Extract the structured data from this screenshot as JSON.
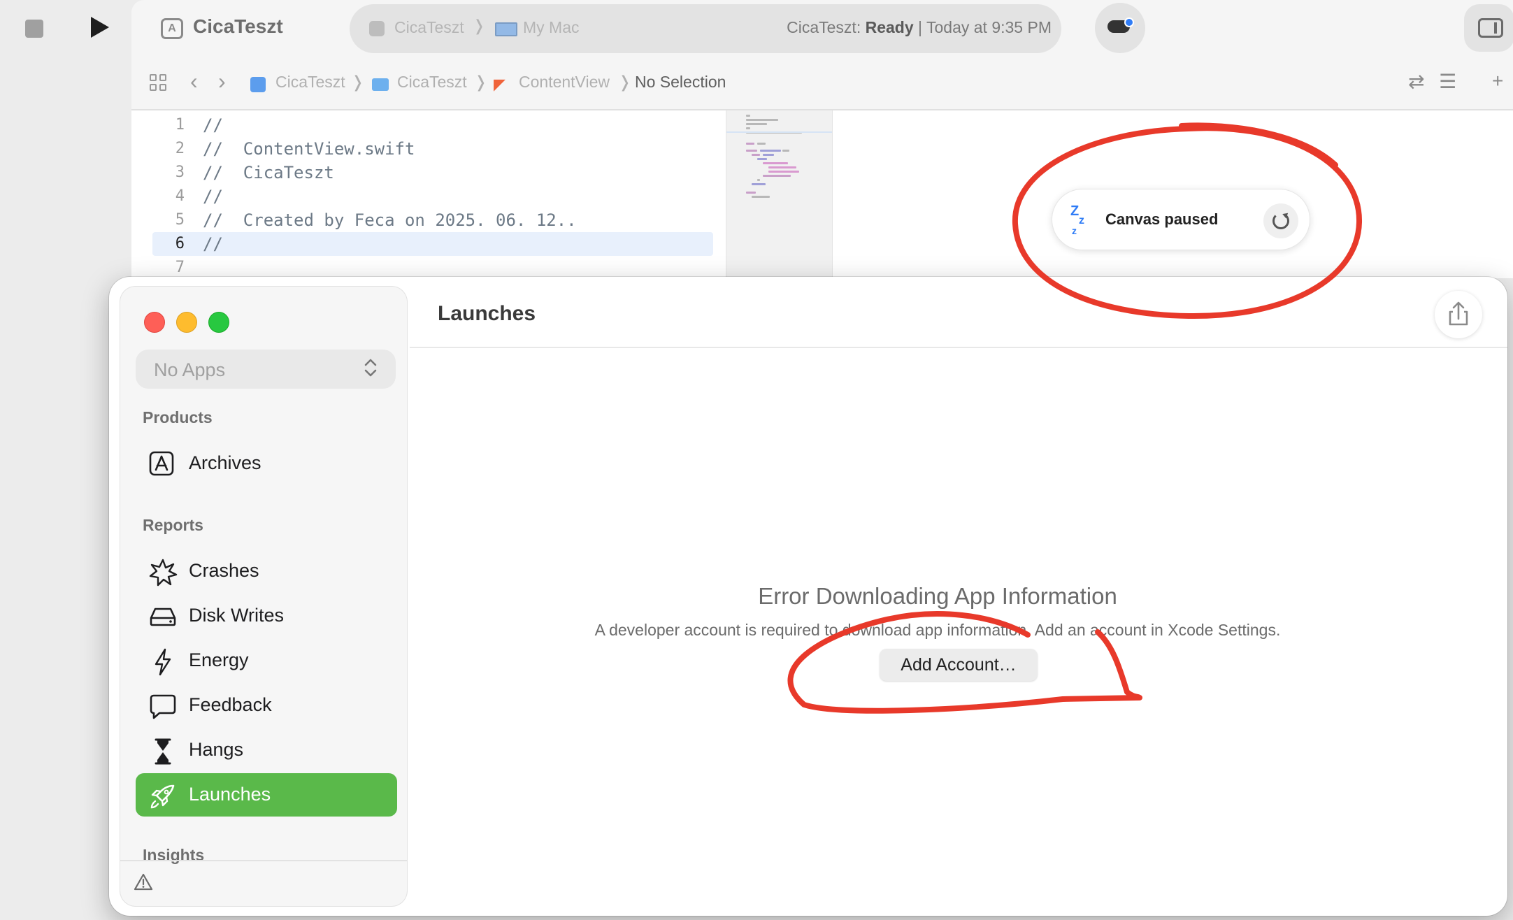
{
  "xcode": {
    "project_title": "CicaTeszt",
    "scheme": {
      "app": "CicaTeszt",
      "destination": "My Mac",
      "status_prefix": "CicaTeszt:",
      "status_state": "Ready",
      "status_time": "| Today at 9:35 PM"
    },
    "jump_bar": {
      "project": "CicaTeszt",
      "folder": "CicaTeszt",
      "file": "ContentView",
      "selection": "No Selection"
    },
    "code_lines": [
      {
        "n": "1",
        "text": "//"
      },
      {
        "n": "2",
        "text": "//  ContentView.swift"
      },
      {
        "n": "3",
        "text": "//  CicaTeszt"
      },
      {
        "n": "4",
        "text": "//"
      },
      {
        "n": "5",
        "text": "//  Created by Feca on 2025. 06. 12.."
      },
      {
        "n": "6",
        "text": "//"
      },
      {
        "n": "7",
        "text": ""
      }
    ],
    "canvas_status": "Canvas paused",
    "icons": {
      "zz": "Z z",
      "chevron": "❭"
    }
  },
  "organizer": {
    "title": "Launches",
    "app_select": "No Apps",
    "sections": {
      "products": "Products",
      "reports": "Reports",
      "insights": "Insights"
    },
    "items": {
      "archives": "Archives",
      "crashes": "Crashes",
      "disk_writes": "Disk Writes",
      "energy": "Energy",
      "feedback": "Feedback",
      "hangs": "Hangs",
      "launches": "Launches"
    },
    "error_title": "Error Downloading App Information",
    "error_message": "A developer account is required to download app information. Add an account in Xcode Settings.",
    "add_account": "Add Account…"
  },
  "colors": {
    "accent_green": "#5ab94a",
    "annotation_red": "#e8392a",
    "link_blue": "#2f7cf6"
  }
}
